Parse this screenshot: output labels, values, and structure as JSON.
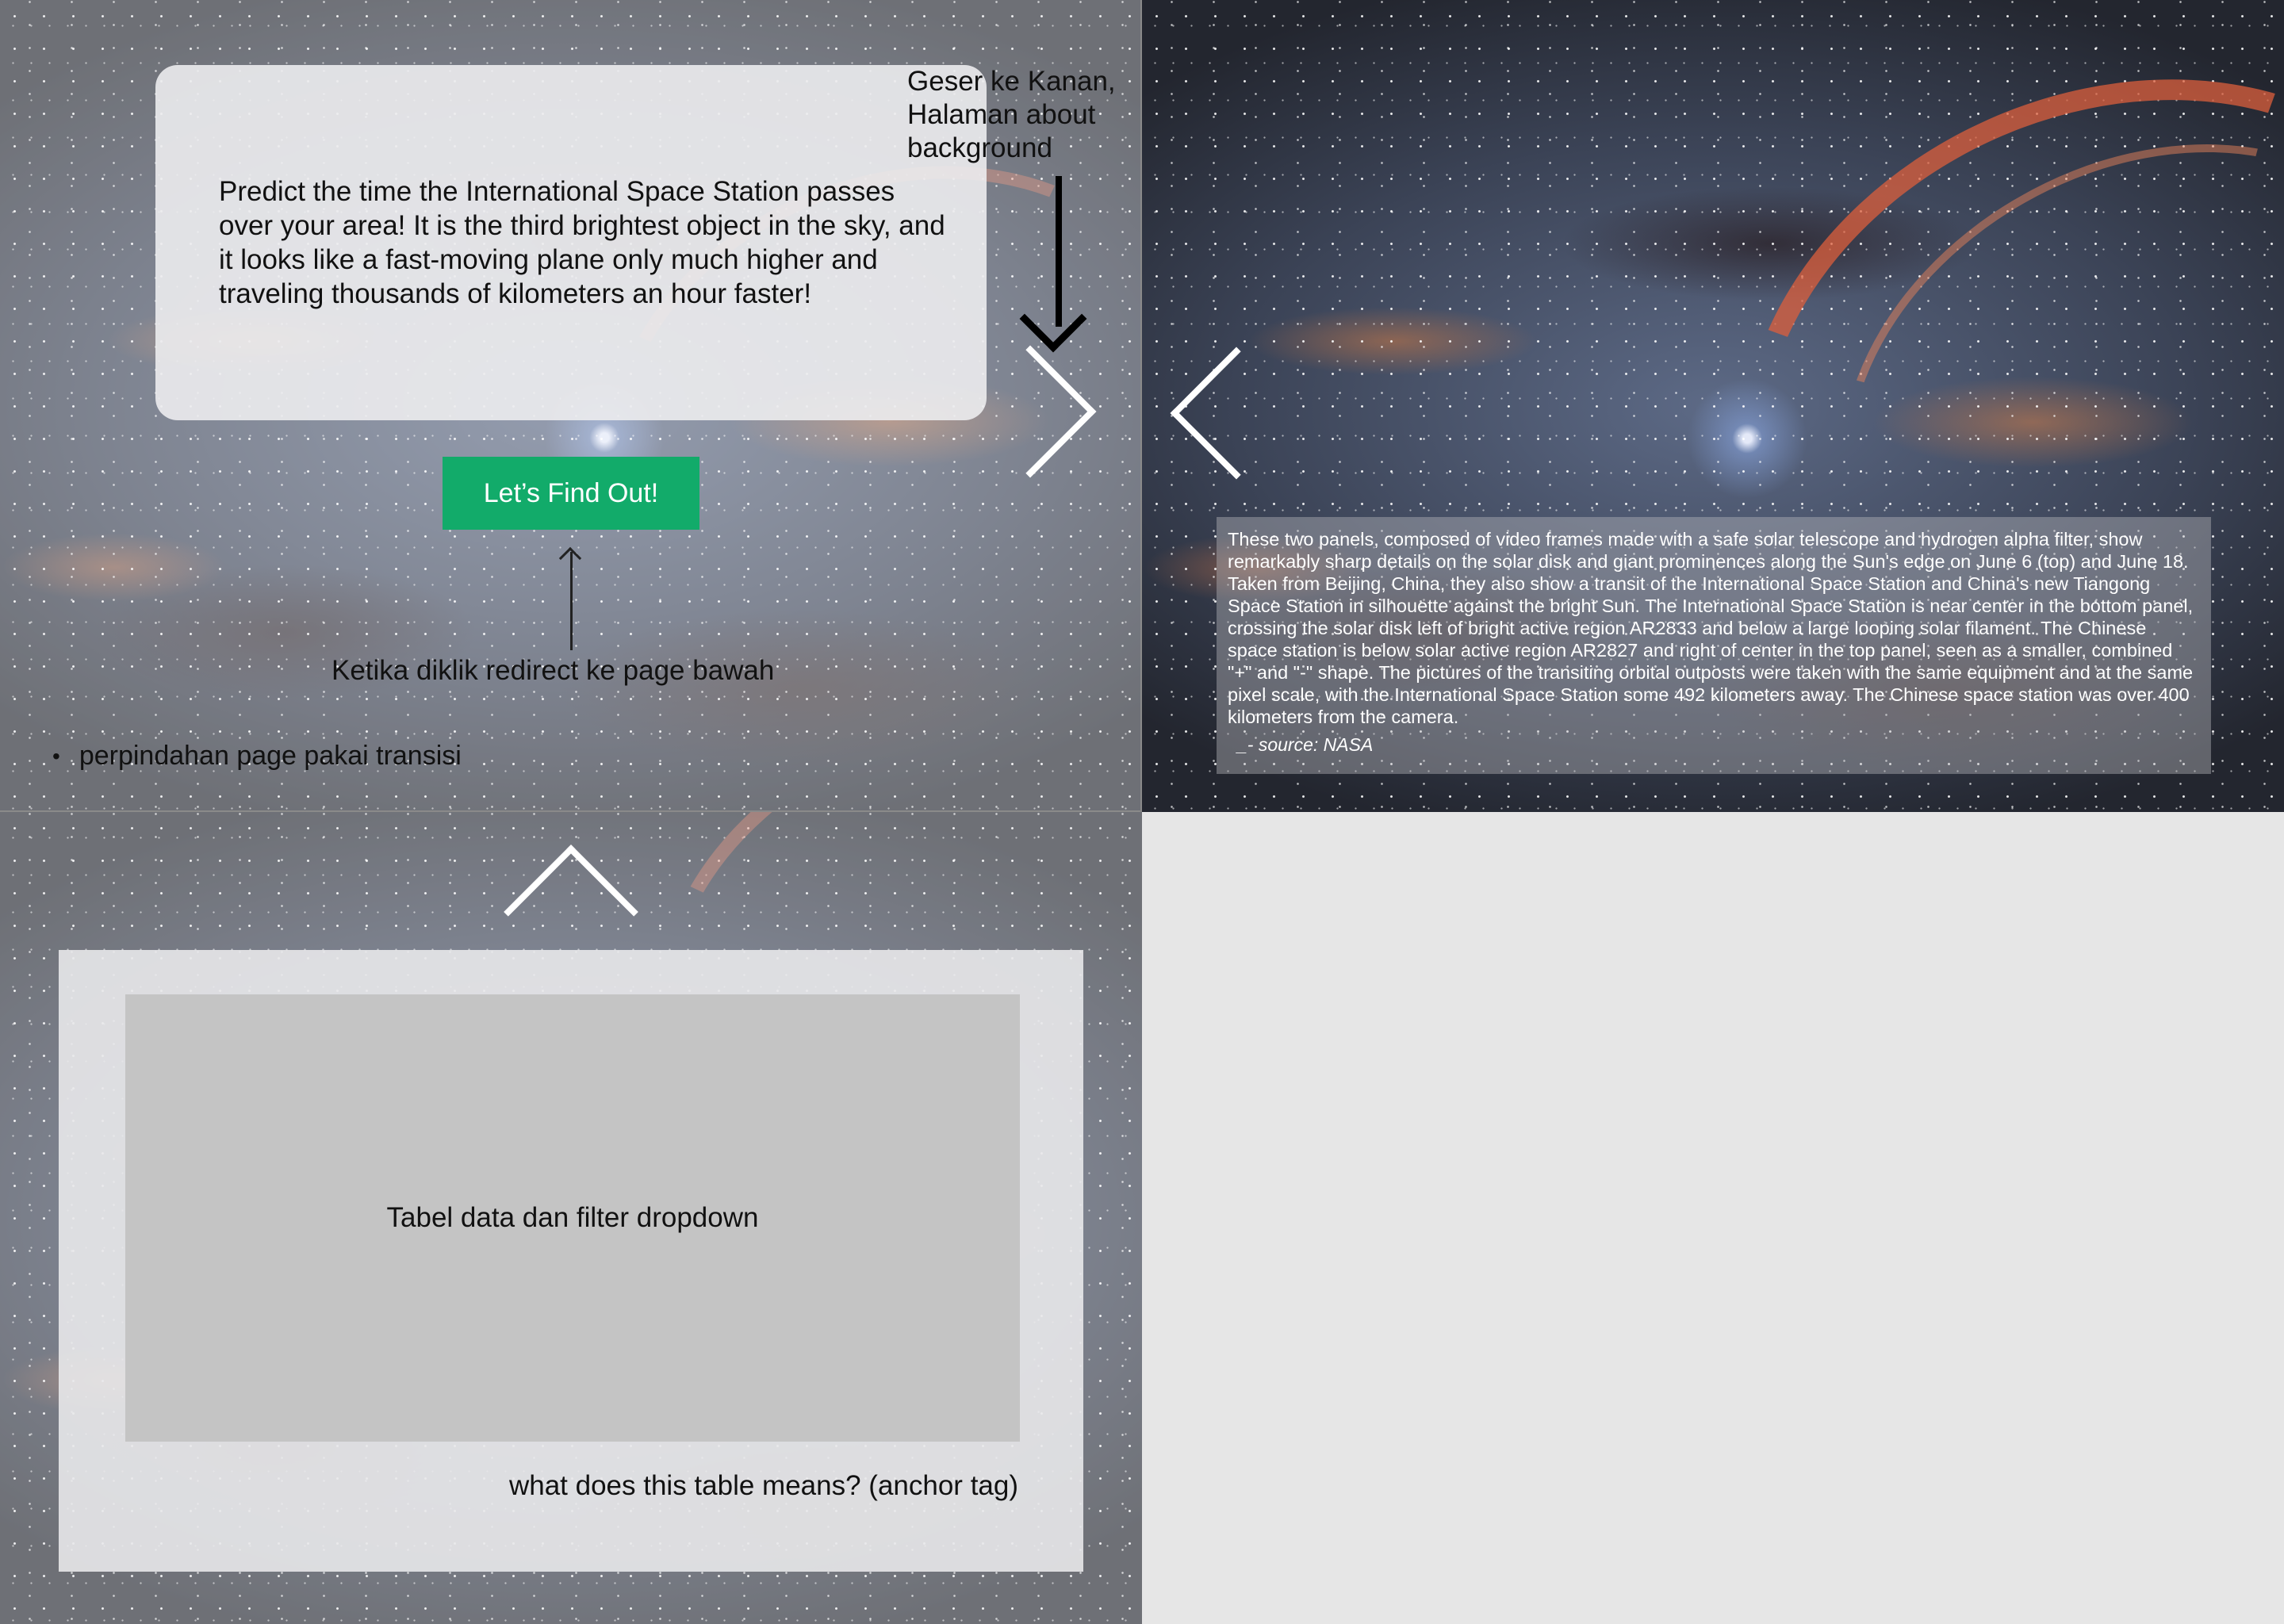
{
  "panel_intro": {
    "intro_text": "Predict the time the International Space Station passes over your area! It is the third brightest object in the sky, and it looks like a fast-moving plane only much higher and traveling thousands of kilometers an hour faster!",
    "note_right": "Geser ke Kanan, Halaman about background",
    "cta_label": "Let’s Find Out!",
    "redirect_note": "Ketika diklik redirect ke page bawah",
    "bullet_char": "•",
    "bullet_note": "perpindahan page pakai transisi"
  },
  "panel_about": {
    "text": "These two panels, composed of video frames made with a safe solar telescope and hydrogen alpha filter, show remarkably sharp details on the solar disk and giant prominences along the Sun's edge on June 6 (top) and June 18. Taken from Beijing, China, they also show a transit of the International Space Station and China's new Tiangong Space Station in silhouette against the bright Sun. The International Space Station is near center in the bottom panel, crossing the solar disk left of bright active region AR2833 and below a large looping solar filament. The Chinese space station is below solar active region AR2827 and right of center in the top panel, seen as a smaller, combined \"+\" and \"-\" shape. The pictures of the transiting orbital outposts were taken with the same equipment and at the same pixel scale, with the International Space Station some 492 kilometers away. The Chinese space station was over 400 kilometers from the camera.",
    "source": "_- source: NASA"
  },
  "panel_table": {
    "table_label": "Tabel data dan filter dropdown",
    "link_label": "what does this table means? (anchor tag)"
  },
  "colors": {
    "cta_green": "#12ab6a",
    "page_background": "#e6e6e6"
  },
  "icons": {
    "next": "chevron-right-icon",
    "prev": "chevron-left-icon",
    "up": "chevron-up-icon",
    "annotation_arrow": "arrow-down-icon"
  }
}
